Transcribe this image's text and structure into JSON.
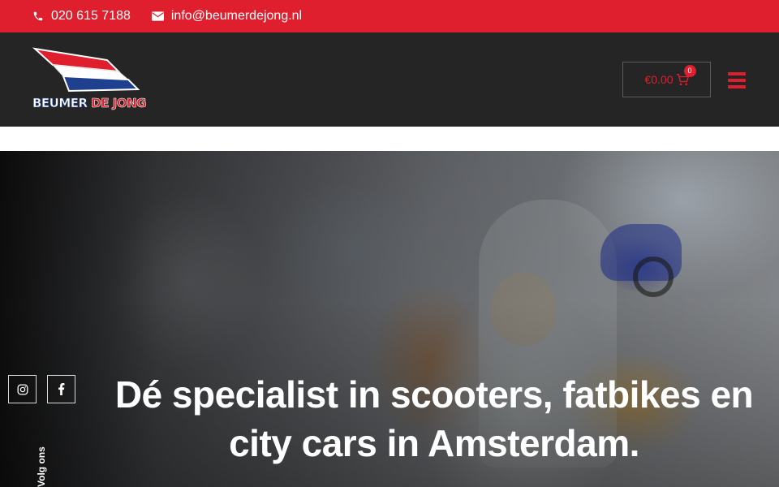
{
  "topbar": {
    "phone": "020 615 7188",
    "email": "info@beumerdejong.nl"
  },
  "header": {
    "logo": {
      "word_part1": "BEUMER",
      "word_part2": "DE JONG",
      "flag_colors": [
        "#df1f2d",
        "#ffffff",
        "#1f3f8f"
      ]
    },
    "cart": {
      "amount": "€0.00",
      "count": "0"
    }
  },
  "hero": {
    "social": {
      "follow_label": "Volg ons",
      "icons": [
        "instagram-icon",
        "facebook-icon"
      ]
    },
    "title_line1": "Dé specialist in scooters, fatbikes en",
    "title_line2": "city cars in Amsterdam."
  },
  "colors": {
    "accent": "#df1f2d",
    "header_bg": "#252525",
    "text_light": "#ffffff"
  }
}
